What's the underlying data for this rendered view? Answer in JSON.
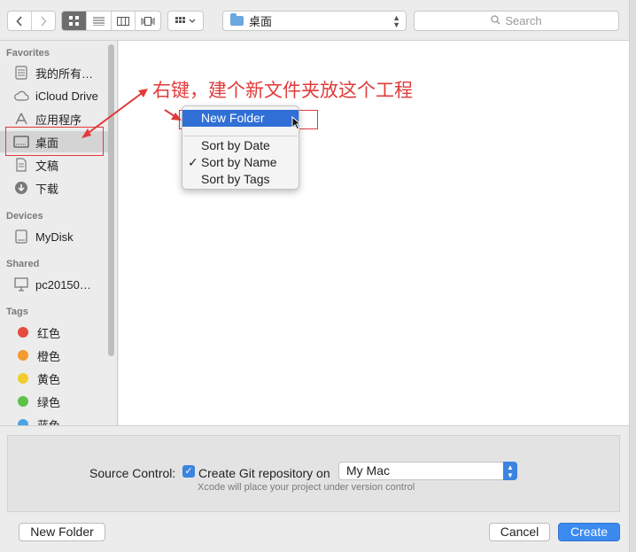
{
  "toolbar": {
    "back_icon": "chevron-left",
    "forward_icon": "chevron-right",
    "view_modes": [
      "icon-view",
      "list-view",
      "column-view",
      "cover-flow-view"
    ],
    "arrange_icon": "grid-arrange",
    "path": "桌面",
    "search_placeholder": "Search"
  },
  "sidebar": {
    "favorites_heading": "Favorites",
    "favorites": [
      {
        "label": "我的所有…",
        "icon": "all-files-icon"
      },
      {
        "label": "iCloud Drive",
        "icon": "cloud-icon"
      },
      {
        "label": "应用程序",
        "icon": "applications-icon"
      },
      {
        "label": "桌面",
        "icon": "desktop-icon",
        "selected": true
      },
      {
        "label": "文稿",
        "icon": "documents-icon"
      },
      {
        "label": "下载",
        "icon": "downloads-icon"
      }
    ],
    "devices_heading": "Devices",
    "devices": [
      {
        "label": "MyDisk",
        "icon": "disk-icon"
      }
    ],
    "shared_heading": "Shared",
    "shared": [
      {
        "label": "pc20150…",
        "icon": "computer-icon"
      }
    ],
    "tags_heading": "Tags",
    "tags": [
      {
        "label": "红色",
        "color": "#e64a3f"
      },
      {
        "label": "橙色",
        "color": "#f29a2e"
      },
      {
        "label": "黄色",
        "color": "#f2cb2e"
      },
      {
        "label": "绿色",
        "color": "#5cc24a"
      },
      {
        "label": "蓝色",
        "color": "#4aa3e6"
      }
    ]
  },
  "context_menu": {
    "new_folder": "New Folder",
    "sort_by_date": "Sort by Date",
    "sort_by_name": "Sort by Name",
    "sort_by_tags": "Sort by Tags",
    "checkmark": "✓"
  },
  "annotation": {
    "text": "右键，建个新文件夹放这个工程",
    "color": "#e03b3b"
  },
  "source_control": {
    "label": "Source Control:",
    "checkbox_label": "Create Git repository on",
    "checked": true,
    "location": "My Mac",
    "hint": "Xcode will place your project under version control"
  },
  "buttons": {
    "new_folder": "New Folder",
    "cancel": "Cancel",
    "create": "Create"
  }
}
